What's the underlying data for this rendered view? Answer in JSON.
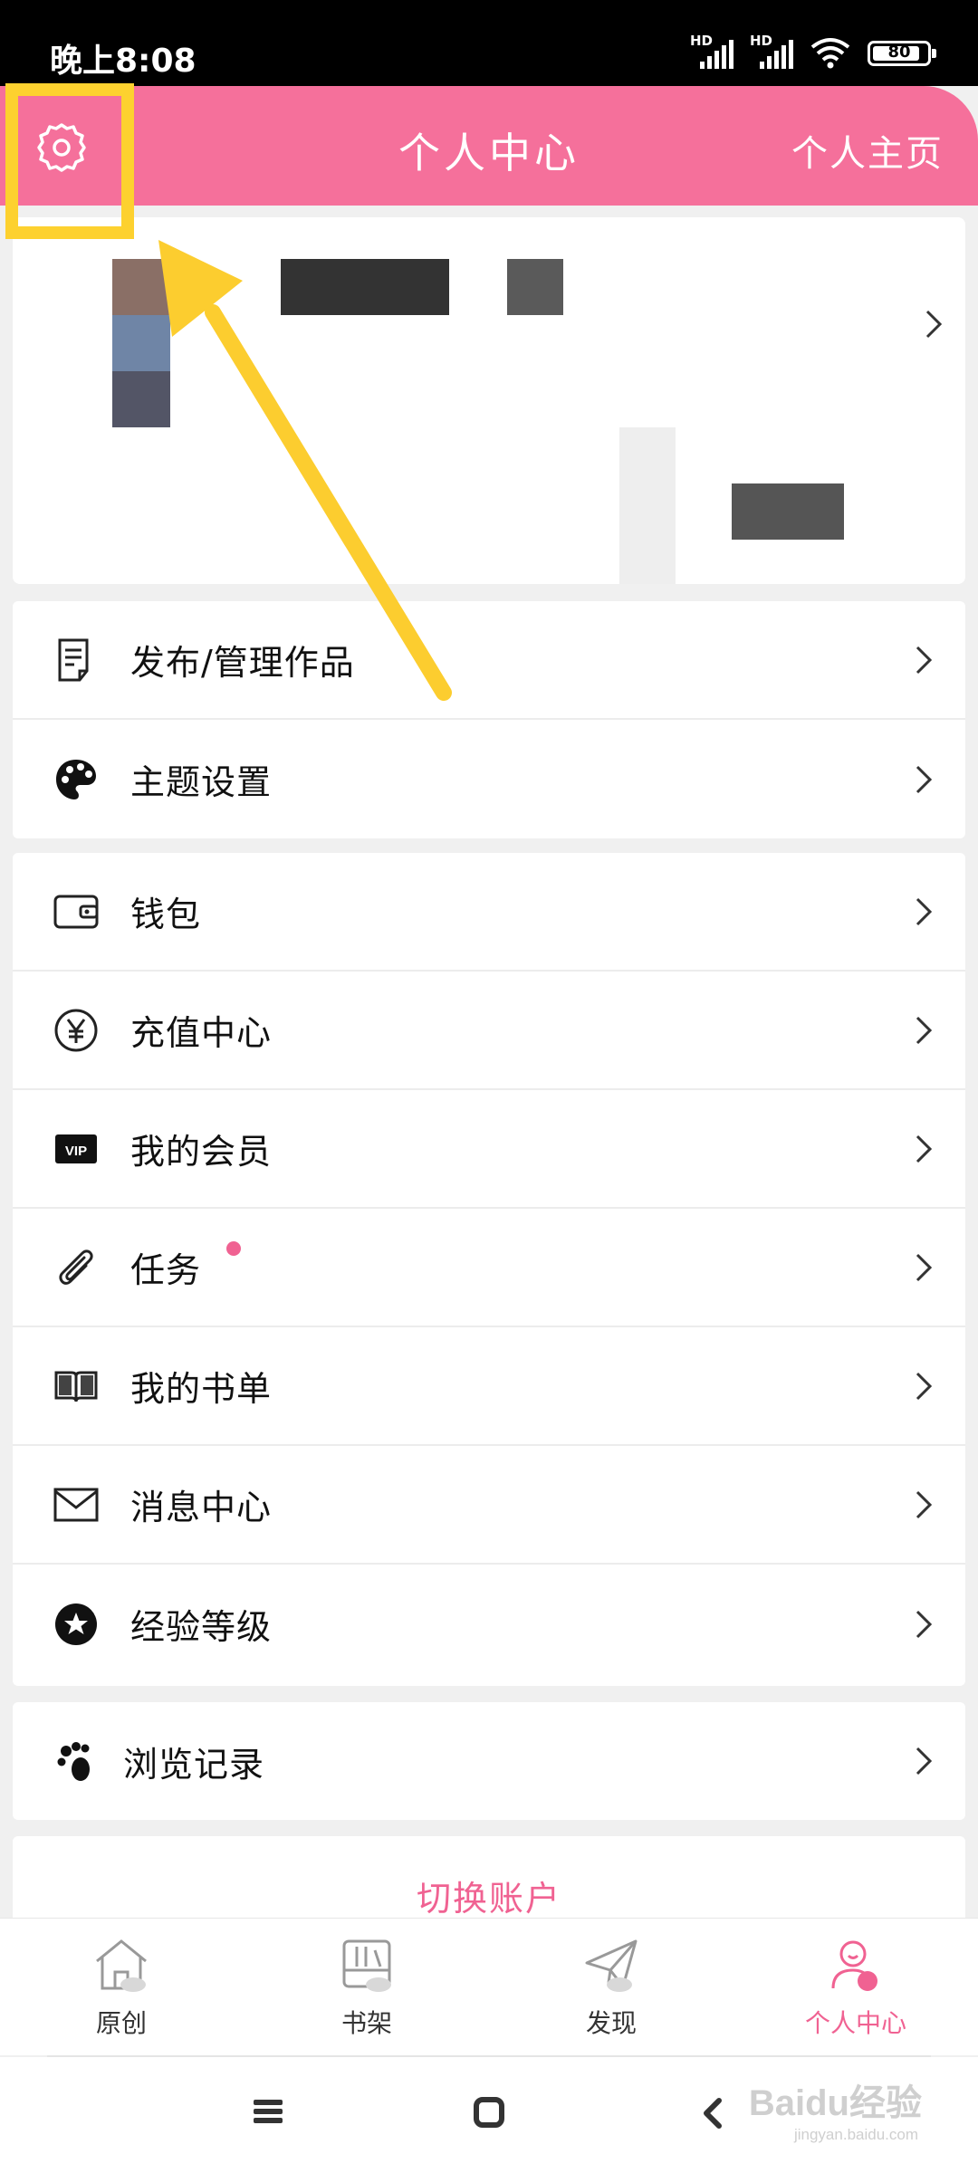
{
  "status_bar": {
    "time": "晚上8:08",
    "signal_1_label": "HD",
    "signal_2_label": "HD",
    "battery_level": "80"
  },
  "header": {
    "title": "个人中心",
    "right_link": "个人主页",
    "settings_icon": "gear-icon",
    "accent_color": "#f5709b"
  },
  "menu_section_1": [
    {
      "label": "发布/管理作品",
      "icon": "document-icon"
    },
    {
      "label": "主题设置",
      "icon": "palette-icon"
    }
  ],
  "menu_section_2": [
    {
      "label": "钱包",
      "icon": "wallet-icon"
    },
    {
      "label": "充值中心",
      "icon": "yen-icon"
    },
    {
      "label": "我的会员",
      "icon": "vip-icon",
      "icon_text": "VIP"
    },
    {
      "label": "任务",
      "icon": "paperclip-icon",
      "badge": "red-dot"
    },
    {
      "label": "我的书单",
      "icon": "book-icon"
    },
    {
      "label": "消息中心",
      "icon": "mail-icon"
    },
    {
      "label": "经验等级",
      "icon": "star-badge-icon"
    }
  ],
  "menu_section_3": [
    {
      "label": "浏览记录",
      "icon": "footprint-icon"
    }
  ],
  "switch_account_label": "切换账户",
  "bottom_nav": [
    {
      "label": "原创",
      "icon": "house-icon",
      "active": false
    },
    {
      "label": "书架",
      "icon": "bookshelf-icon",
      "active": false
    },
    {
      "label": "发现",
      "icon": "paper-plane-icon",
      "active": false
    },
    {
      "label": "个人中心",
      "icon": "user-icon",
      "active": true
    }
  ],
  "watermark": {
    "brand": "Baidu经验",
    "url": "jingyan.baidu.com"
  },
  "colors": {
    "pink": "#f06292",
    "highlight_yellow": "#fdd12f"
  }
}
